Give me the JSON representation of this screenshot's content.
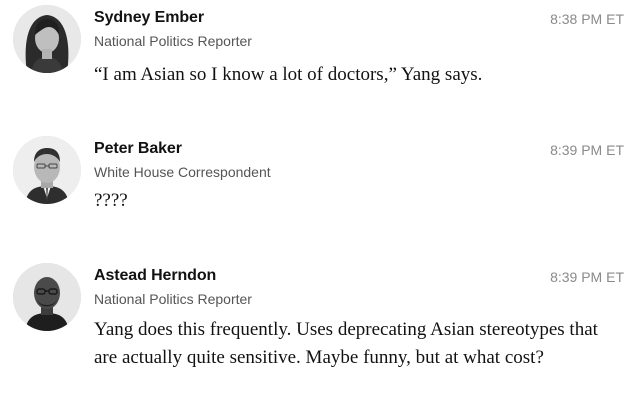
{
  "posts": [
    {
      "author": "Sydney Ember",
      "role": "National Politics Reporter",
      "time": "8:38 PM ET",
      "text": "“I am Asian so I know a lot of doctors,” Yang says.",
      "avatar_icon": "portrait-avatar"
    },
    {
      "author": "Peter Baker",
      "role": "White House Correspondent",
      "time": "8:39 PM ET",
      "text": "????",
      "avatar_icon": "portrait-avatar"
    },
    {
      "author": "Astead Herndon",
      "role": "National Politics Reporter",
      "time": "8:39 PM ET",
      "text": "Yang does this frequently. Uses deprecating Asian stereotypes that are actually quite sensitive. Maybe funny, but at what cost?",
      "avatar_icon": "portrait-avatar"
    }
  ],
  "colors": {
    "name": "#121212",
    "role": "#555555",
    "time": "#8a8a8a",
    "body": "#121212"
  }
}
